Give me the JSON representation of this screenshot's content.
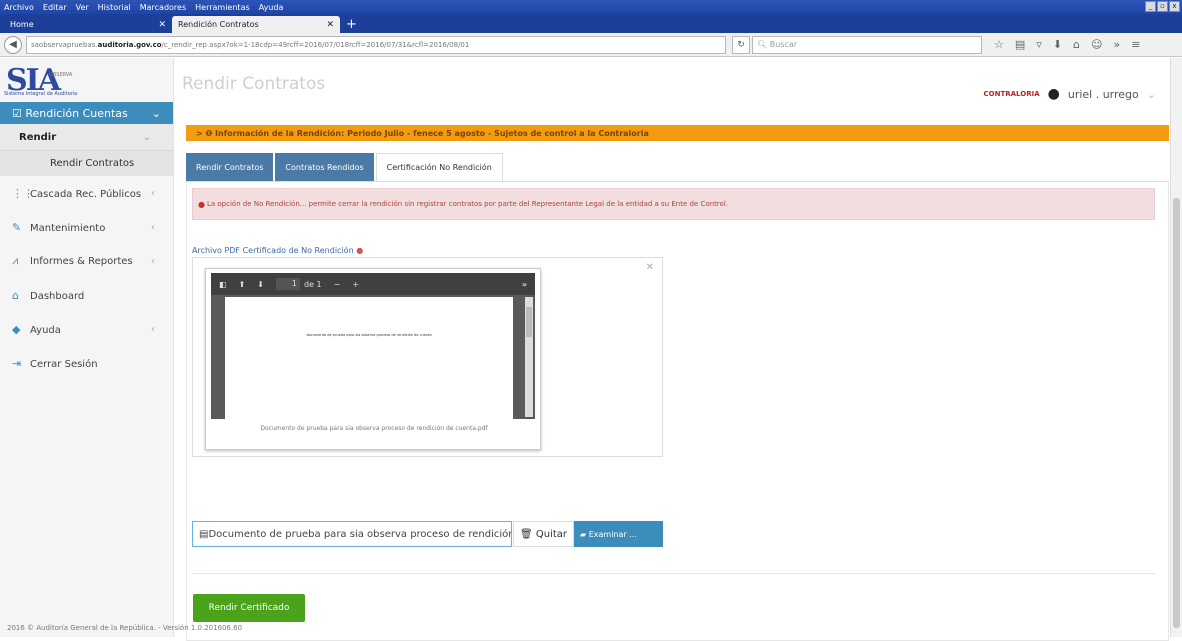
{
  "browser": {
    "menu": [
      "Archivo",
      "Editar",
      "Ver",
      "Historial",
      "Marcadores",
      "Herramientas",
      "Ayuda"
    ],
    "tabs": [
      {
        "label": "Home"
      },
      {
        "label": "Rendición Contratos"
      }
    ],
    "url_prefix": "saobservapruebas.",
    "url_domain": "auditoria.gov.co",
    "url_rest": "/c_rendir_rep.aspx?ok=1-18cdp=49rcff=2016/07/018rcff=2016/07/31&rcfl=2016/08/01",
    "search_placeholder": "Buscar"
  },
  "header": {
    "logo": "SIA",
    "logo_sub": "OBSERVA",
    "logo_tagline": "Sistema Integral de Auditoría",
    "ghost_title": "Rendir Contratos",
    "contraloria": "CONTRALORIA",
    "username": "uriel . urrego"
  },
  "sidebar": {
    "active": "Rendición Cuentas",
    "sub": "Rendir",
    "sub2": "Rendir Contratos",
    "items": [
      {
        "label": "Cascada Rec. Públicos",
        "icon": "grid-icon"
      },
      {
        "label": "Mantenimiento",
        "icon": "wrench-icon"
      },
      {
        "label": "Informes & Reportes",
        "icon": "chart-icon"
      },
      {
        "label": "Dashboard",
        "icon": "home-icon"
      },
      {
        "label": "Ayuda",
        "icon": "book-icon"
      },
      {
        "label": "Cerrar Sesión",
        "icon": "logout-icon"
      }
    ]
  },
  "info_bar": "> ❶ Información de la Rendición: Periodo Julio - fenece 5 agosto - Sujetos de control a la Contraloria",
  "tabs": [
    "Rendir Contratos",
    "Contratos Rendidos",
    "Certificación No Rendición"
  ],
  "alert": "La opción de No Rendición... permite cerrar la rendición sin registrar contratos por parte del Representante Legal de la entidad a su Ente de Control.",
  "file_label": "Archivo PDF Certificado de No Rendición",
  "pdf_viewer": {
    "page": "1",
    "of": "de 1",
    "page_text": "documento de prueba para sia observa proceso de rendición de cuenta",
    "caption": "Documento de prueba para sia observa proceso de rendición de cuenta.pdf"
  },
  "file_input_value": "Documento de prueba para sia observa proceso de rendición",
  "quitar_label": "Quitar",
  "examinar_label": "Examinar ...",
  "submit_label": "Rendir Certificado",
  "footer": "2016 © Auditoría General de la República. - Versión 1.0.201606.60"
}
